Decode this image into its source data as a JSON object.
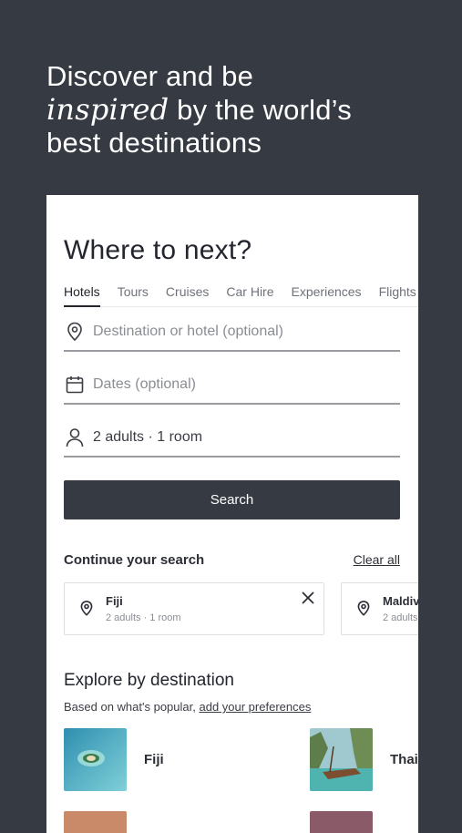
{
  "hero": {
    "line1": "Discover and be",
    "line2_italic": "inspired",
    "line2_rest": " by the world’s",
    "line3": "best destinations"
  },
  "search": {
    "title": "Where to next?",
    "tabs": [
      "Hotels",
      "Tours",
      "Cruises",
      "Car Hire",
      "Experiences",
      "Flights"
    ],
    "active_tab": "Hotels",
    "destination_placeholder": "Destination or hotel (optional)",
    "dates_placeholder": "Dates (optional)",
    "guests_value": "2 adults · 1 room",
    "search_button": "Search"
  },
  "recent": {
    "heading": "Continue your search",
    "clear_label": "Clear all",
    "items": [
      {
        "name": "Fiji",
        "details": "2 adults · 1 room"
      },
      {
        "name": "Maldiv",
        "details": "2 adults"
      }
    ]
  },
  "explore": {
    "heading": "Explore by destination",
    "subtitle_prefix": "Based on what's popular, ",
    "subtitle_link": "add your preferences",
    "destinations": [
      {
        "name": "Fiji",
        "thumb_color": "#4fa7c2"
      },
      {
        "name": "Thai",
        "thumb_color": "#5fb9b8"
      }
    ]
  },
  "colors": {
    "background": "#363a43",
    "card": "#ffffff",
    "button": "#363a43",
    "text_dark": "#23262d",
    "muted": "#8a8d93"
  }
}
